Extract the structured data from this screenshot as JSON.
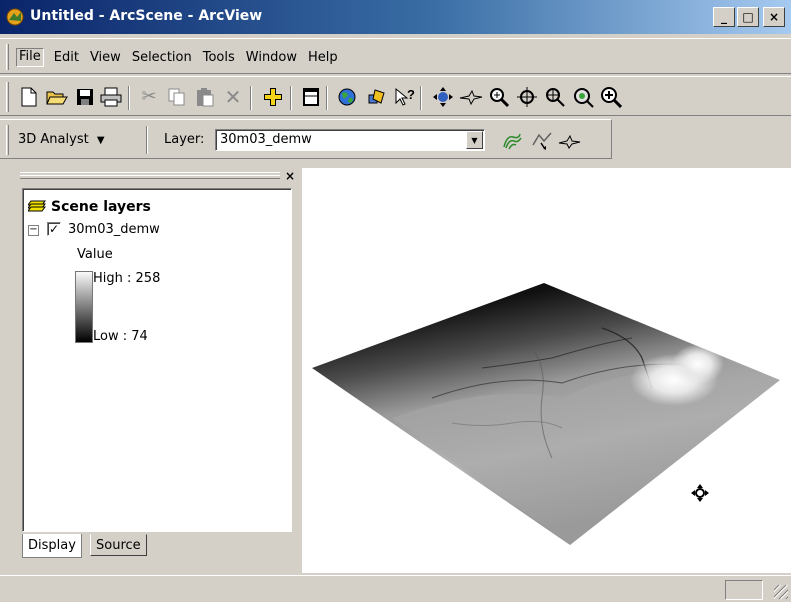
{
  "window": {
    "title": "Untitled - ArcScene - ArcView",
    "minimize": "_",
    "maximize": "□",
    "close": "×"
  },
  "menubar": {
    "items": [
      "File",
      "Edit",
      "View",
      "Selection",
      "Tools",
      "Window",
      "Help"
    ]
  },
  "toolbar": {
    "icons": [
      "new-icon",
      "open-icon",
      "save-icon",
      "print-icon",
      "cut-icon",
      "copy-icon",
      "paste-icon",
      "delete-icon",
      "add-data-icon",
      "scene-properties-icon",
      "globe-icon",
      "animation-icon",
      "whats-this-icon",
      "navigate-icon",
      "fly-icon",
      "zoom-in-out-icon",
      "center-target-icon",
      "zoom-to-target-icon",
      "full-extent-icon",
      "zoom-in-icon"
    ]
  },
  "analyst_toolbar": {
    "menu_label": "3D Analyst",
    "layer_label": "Layer:",
    "layer_value": "30m03_demw",
    "icons": [
      "contour-icon",
      "steepest-path-icon",
      "line-of-sight-icon"
    ]
  },
  "toc": {
    "close": "×",
    "root_label": "Scene layers",
    "layer": {
      "name": "30m03_demw",
      "checked": true,
      "legend_title": "Value",
      "high_label": "High : 258",
      "low_label": "Low : 74"
    },
    "tabs": [
      "Display",
      "Source"
    ]
  },
  "colors": {
    "titlebar_start": "#0a246a",
    "titlebar_end": "#a6caf0",
    "chrome": "#d4d0c8"
  }
}
